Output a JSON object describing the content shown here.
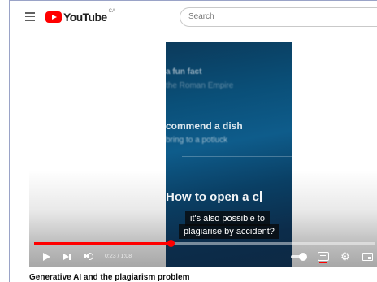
{
  "header": {
    "logo_text": "YouTube",
    "logo_country": "CA",
    "search_placeholder": "Search",
    "icons": [
      "menu-icon",
      "youtube-logo-icon"
    ]
  },
  "video": {
    "frame_text": [
      "a fun fact",
      "the Roman Empire",
      "commend a dish",
      "bring to a potluck",
      "How to open a c"
    ],
    "captions": [
      "it's also possible to",
      "plagiarise by accident?"
    ],
    "time": "0:23 / 1:08",
    "progress_fraction": 0.4,
    "progress_color": "#ff0000"
  },
  "controls": {
    "icons": [
      "play-icon",
      "next-icon",
      "volume-icon",
      "autoplay-toggle-icon",
      "subtitles-icon",
      "settings-gear-icon",
      "miniplayer-icon"
    ],
    "settings_glyph": "⚙"
  },
  "title": "Generative AI and the plagiarism problem",
  "colors": {
    "brand": "#ff0000",
    "video_bg": "#0a4f78"
  }
}
